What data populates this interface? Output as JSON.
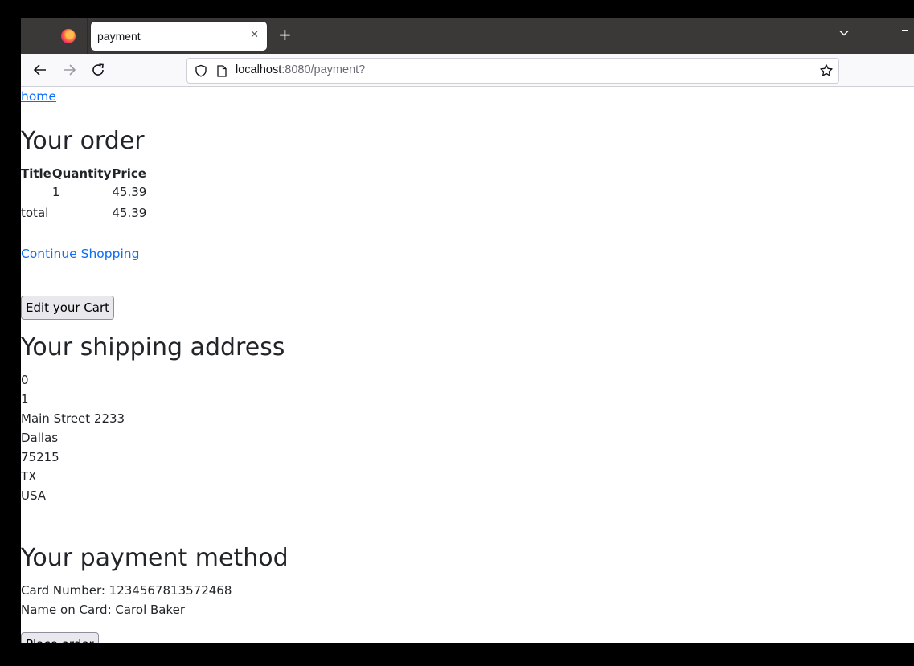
{
  "browser": {
    "tab_title": "payment",
    "tab_close_glyph": "✕",
    "new_tab_glyph": "+",
    "url_host": "localhost",
    "url_rest": ":8080/payment?"
  },
  "page": {
    "home_link": "home",
    "order": {
      "heading": "Your order",
      "columns": [
        "Title",
        "Quantity",
        "Price"
      ],
      "rows": [
        {
          "title": "",
          "quantity": "1",
          "price": "45.39"
        }
      ],
      "total_label": "total",
      "total_price": "45.39"
    },
    "continue_shopping": "Continue Shopping",
    "edit_cart_button": "Edit your Cart",
    "shipping": {
      "heading": "Your shipping address",
      "lines": [
        "0",
        "1",
        "Main Street 2233",
        "Dallas",
        "75215",
        "TX",
        "USA"
      ]
    },
    "payment": {
      "heading": "Your payment method",
      "card_number": "Card Number: 1234567813572468",
      "name_on_card": "Name on Card: Carol Baker"
    },
    "place_order_button": "Place order"
  },
  "icons": {
    "firefox": "firefox-logo-icon",
    "back": "arrow-left-icon",
    "forward": "arrow-right-icon",
    "reload": "reload-icon",
    "shield": "shield-icon",
    "page": "page-icon",
    "bookmark": "star-icon",
    "tab_list": "chevron-down-icon",
    "minimize": "minimize-icon"
  }
}
